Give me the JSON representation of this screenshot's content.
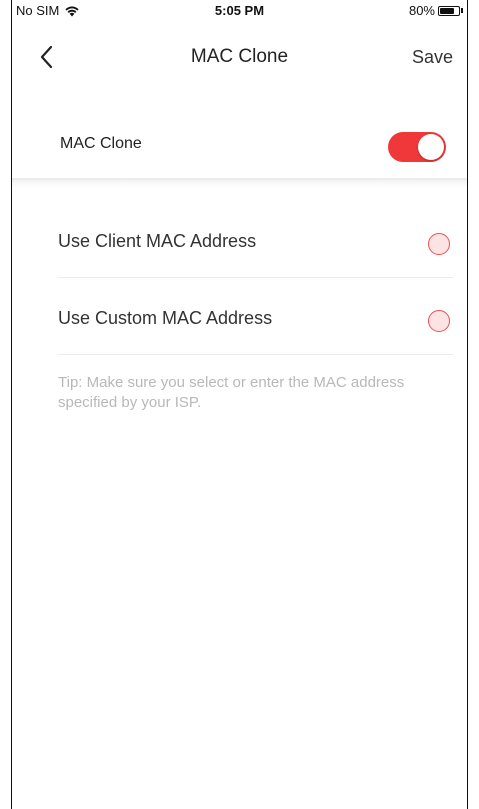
{
  "status_bar": {
    "carrier": "No SIM",
    "time": "5:05 PM",
    "battery": "80%",
    "battery_level": 0.8,
    "icons": [
      "wifi-icon",
      "battery-icon"
    ]
  },
  "nav": {
    "back_icon": "chevron-left-icon",
    "title": "MAC Clone",
    "save_label": "Save"
  },
  "toggle": {
    "label": "MAC Clone",
    "on": true,
    "accent_color": "#f0383a"
  },
  "options": [
    {
      "label": "Use Client MAC Address",
      "selected": false
    },
    {
      "label": "Use Custom MAC Address",
      "selected": false
    }
  ],
  "tip": "Tip: Make sure you select or enter the MAC address specified by your ISP."
}
